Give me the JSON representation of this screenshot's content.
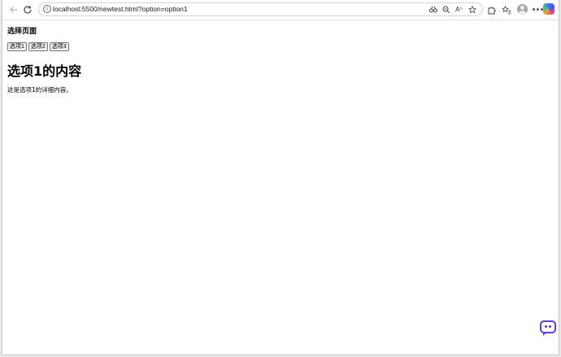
{
  "browser": {
    "url": "localhost:5500/newtest.html?option=option1",
    "read_aloud_label": "Aᴬ",
    "accent_color": "#5a3ff0"
  },
  "page": {
    "heading": "选择页面",
    "buttons": [
      {
        "label": "选项1"
      },
      {
        "label": "选项2"
      },
      {
        "label": "选项3"
      }
    ],
    "content_title": "选项1的内容",
    "content_text": "这是选项1的详细内容。"
  }
}
